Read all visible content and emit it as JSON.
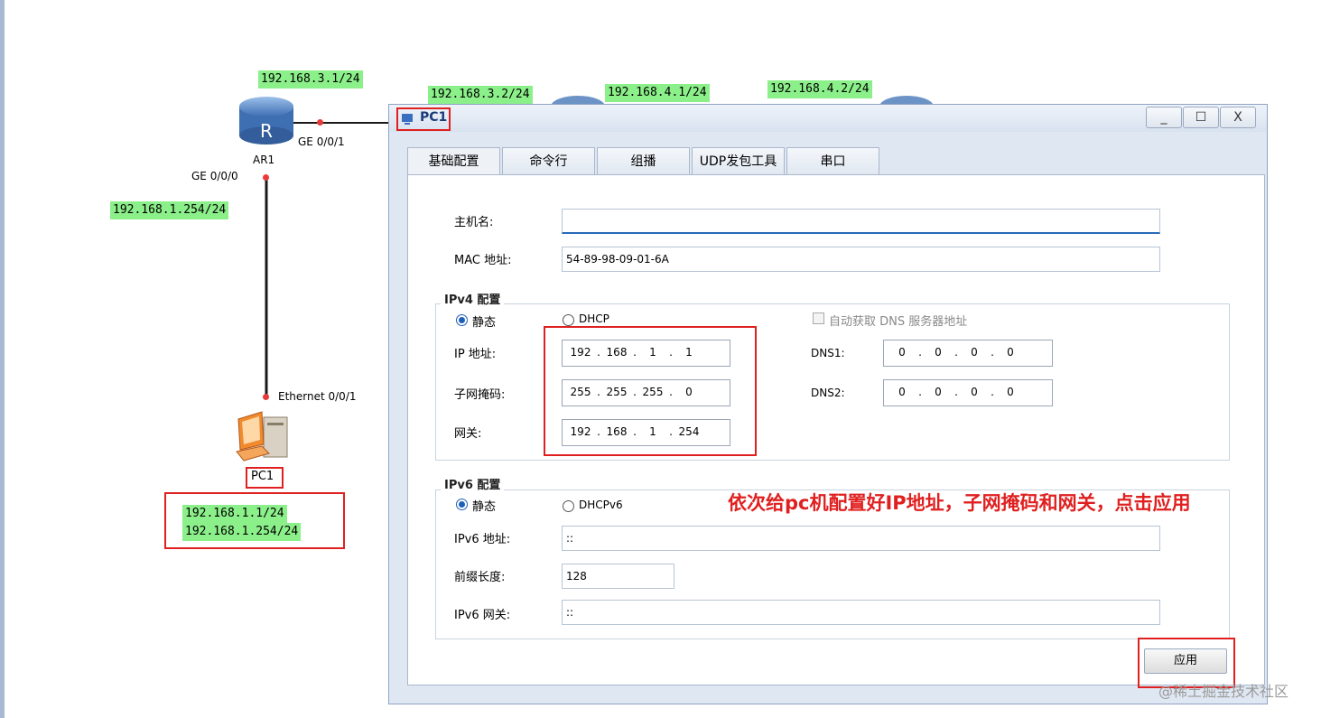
{
  "topology": {
    "labels": {
      "r1_ge001_ip": "192.168.3.1/24",
      "r2_ip_left": "192.168.3.2/24",
      "r2_ip_right": "192.168.4.1/24",
      "r3_ip": "192.168.4.2/24",
      "r1_ge000_ip": "192.168.1.254/24",
      "pc1_ip": "192.168.1.1/24",
      "pc1_gw": "192.168.1.254/24"
    },
    "router_name": "AR1",
    "router_glyph": "R",
    "port_ge001": "GE 0/0/1",
    "port_ge000": "GE 0/0/0",
    "port_eth": "Ethernet 0/0/1",
    "pc_name": "PC1"
  },
  "window": {
    "title": "PC1",
    "min_label": "_",
    "max_label": "☐",
    "close_label": "X",
    "tabs": [
      {
        "label": "基础配置"
      },
      {
        "label": "命令行"
      },
      {
        "label": "组播"
      },
      {
        "label": "UDP发包工具"
      },
      {
        "label": "串口"
      }
    ],
    "hostname_label": "主机名:",
    "hostname_value": "",
    "mac_label": "MAC 地址:",
    "mac_value": "54-89-98-09-01-6A",
    "ipv4": {
      "group_title": "IPv4 配置",
      "static_label": "静态",
      "dhcp_label": "DHCP",
      "auto_dns_label": "自动获取 DNS 服务器地址",
      "ip_label": "IP 地址:",
      "ip_value": [
        "192",
        "168",
        "1",
        "1"
      ],
      "mask_label": "子网掩码:",
      "mask_value": [
        "255",
        "255",
        "255",
        "0"
      ],
      "gw_label": "网关:",
      "gw_value": [
        "192",
        "168",
        "1",
        "254"
      ],
      "dns1_label": "DNS1:",
      "dns1_value": [
        "0",
        "0",
        "0",
        "0"
      ],
      "dns2_label": "DNS2:",
      "dns2_value": [
        "0",
        "0",
        "0",
        "0"
      ]
    },
    "ipv6": {
      "group_title": "IPv6 配置",
      "static_label": "静态",
      "dhcp_label": "DHCPv6",
      "addr_label": "IPv6 地址:",
      "addr_value": "::",
      "prefix_label": "前缀长度:",
      "prefix_value": "128",
      "gw_label": "IPv6 网关:",
      "gw_value": "::"
    },
    "apply_label": "应用"
  },
  "annotation": "依次给pc机配置好IP地址，子网掩码和网关，点击应用",
  "watermark": "@稀土掘金技术社区",
  "colors": {
    "label_bg": "#8cf08a",
    "highlight": "#e02020",
    "link": "#1a1a1a",
    "radio_on": "#1f5fb8"
  }
}
